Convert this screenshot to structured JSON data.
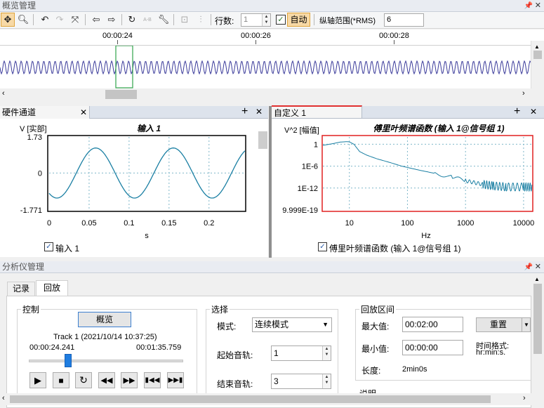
{
  "overview": {
    "title": "概览管理",
    "rows_label": "行数:",
    "rows_value": "1",
    "auto_label": "自动",
    "range_label": "纵轴范围(*RMS)",
    "range_value": "6",
    "times": [
      "00:00:24",
      "00:00:26",
      "00:00:28"
    ],
    "toolbar_icons": [
      "move-icon",
      "zoom-icon",
      "undo-icon",
      "redo-icon",
      "fit-icon",
      "prev-icon",
      "next-icon",
      "refresh-icon",
      "ab-icon",
      "wrench-icon",
      "lock-icon",
      "marker-icon"
    ]
  },
  "hw_panel": {
    "tab": "硬件通道",
    "chart_title": "输入 1",
    "ylabel": "V [实部]",
    "xlabel": "s",
    "legend": "输入 1",
    "color": "#1a7fa3"
  },
  "custom_panel": {
    "tab": "自定义 1",
    "chart_title": "傅里叶频谱函数 (输入 1@信号组 1)",
    "ylabel": "V^2 [幅值]",
    "xlabel": "Hz",
    "legend": "傅里叶频谱函数 (输入 1@信号组 1)",
    "color": "#1a7fa3"
  },
  "analyzer": {
    "title": "分析仪管理",
    "tabs": [
      "记录",
      "回放"
    ],
    "control": {
      "group": "控制",
      "overview_btn": "概览",
      "track": "Track 1 (2021/10/14 10:37:25)",
      "time_current": "00:00:24.241",
      "time_total": "00:01:35.759",
      "position": 0.253
    },
    "select": {
      "group": "选择",
      "mode_label": "模式:",
      "mode_value": "连续模式",
      "start_label": "起始音轨:",
      "start_value": "1",
      "end_label": "结束音轨:",
      "end_value": "3"
    },
    "range": {
      "group": "回放区间",
      "max_label": "最大值:",
      "max_value": "00:02:00",
      "min_label": "最小值:",
      "min_value": "00:00:00",
      "reset_btn": "重置",
      "time_format_label": "时间格式:",
      "time_format_value": "hr:min:s.",
      "length_label": "长度:",
      "length_value": "2min0s",
      "note_label": "说明"
    }
  },
  "chart_data": [
    {
      "type": "line",
      "title": "输入 1",
      "xlabel": "s",
      "ylabel": "V [实部]",
      "x_ticks": [
        "0",
        "0.05",
        "0.1",
        "0.15",
        "0.2"
      ],
      "y_ticks": [
        "1.73",
        "0",
        "-1.771"
      ],
      "xlim": [
        0,
        0.245
      ],
      "ylim": [
        -1.771,
        1.73
      ],
      "series": [
        {
          "name": "输入 1",
          "amplitude": 1.2,
          "frequency_hz": 10.3,
          "phase_rad": -2.2
        }
      ],
      "grid": true
    },
    {
      "type": "line",
      "title": "傅里叶频谱函数 (输入 1@信号组 1)",
      "xlabel": "Hz",
      "ylabel": "V^2 [幅值]",
      "x_scale": "log",
      "y_scale": "log",
      "x_ticks": [
        "10",
        "100",
        "1000",
        "10000"
      ],
      "y_ticks": [
        "1",
        "1E-6",
        "1E-12",
        "9.999E-19"
      ],
      "xlim": [
        3.5,
        14000
      ],
      "ylim": [
        9.999e-19,
        100
      ],
      "series": [
        {
          "name": "傅里叶频谱函数 (输入 1@信号组 1)",
          "points": [
            [
              3.5,
              0.5
            ],
            [
              5,
              1.3
            ],
            [
              7,
              4
            ],
            [
              9,
              5
            ],
            [
              10,
              4.5
            ],
            [
              12,
              1
            ],
            [
              15,
              0.01
            ],
            [
              20,
              0.001
            ],
            [
              30,
              0.0001
            ],
            [
              50,
              1e-05
            ],
            [
              80,
              1e-06
            ],
            [
              150,
              1e-07
            ],
            [
              300,
              1e-08
            ],
            [
              600,
              1e-09
            ],
            [
              1000,
              1e-10
            ],
            [
              2000,
              1e-11
            ],
            [
              3000,
              4e-12
            ],
            [
              5000,
              2e-12
            ],
            [
              10000,
              2e-12
            ],
            [
              14000,
              2e-12
            ]
          ]
        }
      ],
      "grid": true
    }
  ]
}
